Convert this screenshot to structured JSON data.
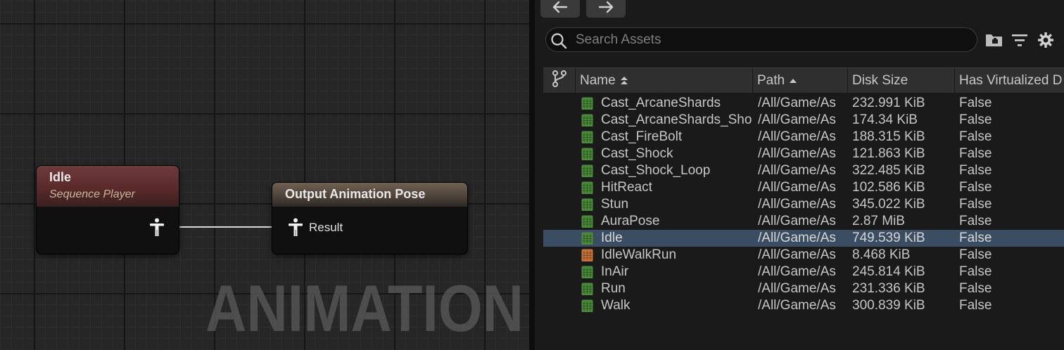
{
  "graph": {
    "watermark": "ANIMATION",
    "idle_node": {
      "title": "Idle",
      "subtitle": "Sequence Player"
    },
    "output_node": {
      "title": "Output Animation Pose",
      "pin_label": "Result"
    }
  },
  "browser": {
    "search": {
      "placeholder": "Search Assets",
      "value": ""
    },
    "columns": {
      "name": "Name",
      "path": "Path",
      "disk_size": "Disk Size",
      "virtualized": "Has Virtualized D"
    },
    "rows": [
      {
        "name": "Cast_ArcaneShards",
        "path": "/All/Game/As",
        "size": "232.991 KiB",
        "virtualized": "False",
        "kind": "sequence"
      },
      {
        "name": "Cast_ArcaneShards_Sho",
        "path": "/All/Game/As",
        "size": "174.34 KiB",
        "virtualized": "False",
        "kind": "sequence"
      },
      {
        "name": "Cast_FireBolt",
        "path": "/All/Game/As",
        "size": "188.315 KiB",
        "virtualized": "False",
        "kind": "sequence"
      },
      {
        "name": "Cast_Shock",
        "path": "/All/Game/As",
        "size": "121.863 KiB",
        "virtualized": "False",
        "kind": "sequence"
      },
      {
        "name": "Cast_Shock_Loop",
        "path": "/All/Game/As",
        "size": "322.485 KiB",
        "virtualized": "False",
        "kind": "sequence"
      },
      {
        "name": "HitReact",
        "path": "/All/Game/As",
        "size": "102.586 KiB",
        "virtualized": "False",
        "kind": "sequence"
      },
      {
        "name": "Stun",
        "path": "/All/Game/As",
        "size": "345.022 KiB",
        "virtualized": "False",
        "kind": "sequence"
      },
      {
        "name": "AuraPose",
        "path": "/All/Game/As",
        "size": "2.87 MiB",
        "virtualized": "False",
        "kind": "sequence"
      },
      {
        "name": "Idle",
        "path": "/All/Game/As",
        "size": "749.539 KiB",
        "virtualized": "False",
        "kind": "sequence",
        "selected": true
      },
      {
        "name": "IdleWalkRun",
        "path": "/All/Game/As",
        "size": "8.468 KiB",
        "virtualized": "False",
        "kind": "blendspace"
      },
      {
        "name": "InAir",
        "path": "/All/Game/As",
        "size": "245.814 KiB",
        "virtualized": "False",
        "kind": "sequence"
      },
      {
        "name": "Run",
        "path": "/All/Game/As",
        "size": "231.336 KiB",
        "virtualized": "False",
        "kind": "sequence"
      },
      {
        "name": "Walk",
        "path": "/All/Game/As",
        "size": "300.839 KiB",
        "virtualized": "False",
        "kind": "sequence"
      }
    ]
  },
  "icons": {
    "back": "arrow-left-icon",
    "forward": "arrow-right-icon",
    "search": "search-icon",
    "folder": "folder-icon",
    "filter": "filter-icon",
    "settings": "gear-icon",
    "source_control": "branch-icon",
    "pose_pin": "pose-pin-icon"
  },
  "colors": {
    "sequence_icon": "#4a8a3a",
    "blendspace_icon": "#c8733a",
    "selected_row": "#3b4d63",
    "idle_header": "#6e3b3b",
    "output_header": "#6f6153"
  }
}
